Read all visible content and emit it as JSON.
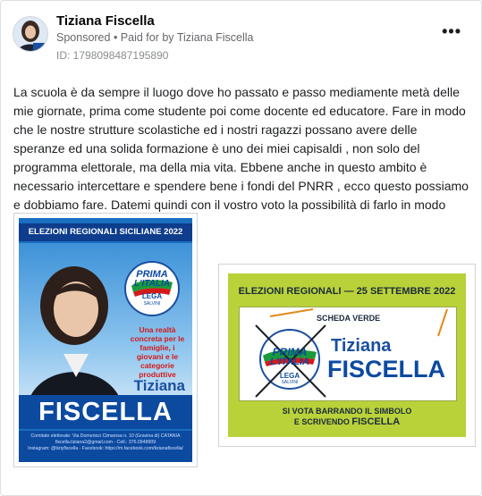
{
  "post": {
    "author_name": "Tiziana Fiscella",
    "sponsored_label": "Sponsored",
    "separator": " • ",
    "paid_prefix": "Paid for by ",
    "paid_by": "Tiziana Fiscella",
    "ad_id": "ID: 1798098487195890",
    "more_label": "•••",
    "body": "La scuola è da sempre il luogo dove ho passato e passo mediamente metà delle mie giornate, prima come studente poi come docente ed educatore. Fare in modo che le nostre strutture scolastiche ed i nostri ragazzi possano avere delle speranze ed una solida formazione è uno dei miei capisaldi , non solo del programma elettorale, ma della mia vita. Ebbene anche in questo ambito è necessario intercettare e spendere bene i fondi del PNRR , ecco questo possiamo e dobbiamo fare. Datemi quindi con il vostro voto la possibilità di farlo in modo sempre più..."
  },
  "poster1": {
    "banner": "ELEZIONI REGIONALI SICILIANE 2022",
    "logo_line1": "PRIMA",
    "logo_line2": "L'ITALIA",
    "logo_sub": "LEGA",
    "logo_sub2": "SALVINI",
    "slogan": "Una realtà concreta per le famiglie, i giovani e le categorie produttive",
    "first_name": "Tiziana",
    "last_name": "FISCELLA",
    "footer_line1": "Comitato elettorale: Via Domenico Cimarosa n. 10 (Gravina di) CATANIA",
    "footer_line2": "fiscella.tiziana2@gmail.com - Cell.: 376.0948909",
    "footer_line3": "Instagram: @tiziyfiscella - Facebook: https://m.facebook.com/tizianafiscella/"
  },
  "poster2": {
    "title": "ELEZIONI REGIONALI — 25 SETTEMBRE 2022",
    "scheda": "SCHEDA VERDE",
    "logo_line1": "PRIMA",
    "logo_line2": "L'ITALIA",
    "logo_sub": "LEGA",
    "logo_sub2": "SALVINI",
    "first_name": "Tiziana",
    "last_name": "FISCELLA",
    "note_line1": "SI VOTA BARRANDO IL SIMBOLO",
    "note_line2_prefix": "E SCRIVENDO ",
    "note_line2_name": "FISCELLA"
  },
  "colors": {
    "brand_blue": "#0c4aa0",
    "accent_red": "#d41919",
    "ballot_green": "#b9d23a"
  }
}
